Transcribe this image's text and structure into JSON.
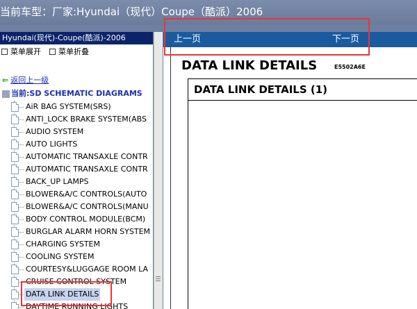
{
  "window": {
    "title": "当前车型：厂家:Hyundai（现代）Coupe（酷派）2006"
  },
  "sidebar": {
    "header": "Hyundai(现代)-Coupe(酷派)-2006",
    "expand_label": "菜单展开",
    "collapse_label": "菜单折叠",
    "back_label": "返回上一级",
    "current_label": "当前:SD SCHEMATIC DIAGRAMS",
    "items": [
      "AiR BAG SYSTEM(SRS)",
      "ANTI_LOCK BRAKE SYSTEM(ABS",
      "AUDIO SYSTEM",
      "AUTO LIGHTS",
      "AUTOMATIC TRANSAXLE CONTR",
      "AUTOMATIC TRANSAXLE CONTR",
      "BACK_UP LAMPS",
      "BLOWER&A/C CONTROLS(AUTO",
      "BLOWER&A/C CONTROLS(MANU",
      "BODY CONTROL MODULE(BCM)",
      "BURGLAR ALARM HORN SYSTEM",
      "CHARGING SYSTEM",
      "COOLING SYSTEM",
      "COURTESY&LUGGAGE ROOM LA",
      "CRUISE CONTROL SYSTEM",
      "DATA LINK DETAILS",
      "DAYTIME RUNNING LIGHTS"
    ],
    "selected_index": 15
  },
  "content": {
    "prev_label": "上一页",
    "next_label": "下一页",
    "doc_title": "DATA LINK DETAILS",
    "doc_code": "E5502A6E",
    "box_title": "DATA LINK DETAILS (1)"
  },
  "colors": {
    "nav_bar": "#1a5ba0",
    "sidebar_header": "#0a246a",
    "highlight_box": "#ee3333"
  }
}
